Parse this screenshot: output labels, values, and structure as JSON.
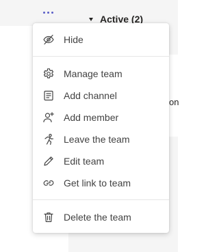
{
  "header": {
    "section_title": "Active (2)",
    "edge_fragment": "on"
  },
  "menu": {
    "items": [
      {
        "label": "Hide",
        "icon": "hide-icon"
      },
      {
        "label": "Manage team",
        "icon": "gear-icon"
      },
      {
        "label": "Add channel",
        "icon": "channel-icon"
      },
      {
        "label": "Add member",
        "icon": "add-person-icon"
      },
      {
        "label": "Leave the team",
        "icon": "leave-icon"
      },
      {
        "label": "Edit team",
        "icon": "pencil-icon"
      },
      {
        "label": "Get link to team",
        "icon": "link-icon"
      },
      {
        "label": "Delete the team",
        "icon": "trash-icon"
      }
    ]
  },
  "colors": {
    "accent": "#5b5fc7",
    "text": "#424242",
    "panel_bg": "#f5f5f5"
  }
}
